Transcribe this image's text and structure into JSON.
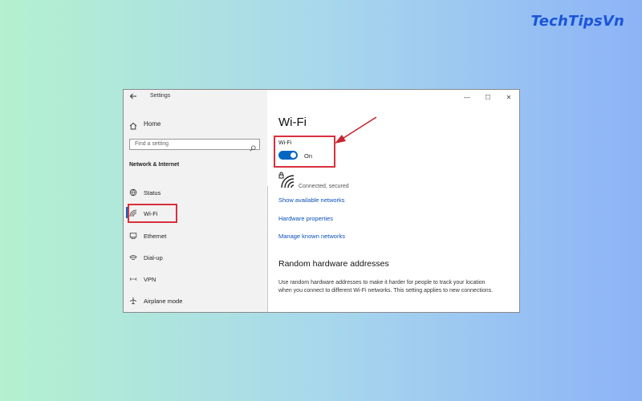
{
  "brand": "TechTipsVn",
  "window": {
    "app_title": "Settings",
    "controls": {
      "minimize": "—",
      "maximize": "☐",
      "close": "✕"
    }
  },
  "sidebar": {
    "home_label": "Home",
    "search_placeholder": "Find a setting",
    "section_title": "Network & Internet",
    "items": [
      {
        "label": "Status",
        "icon": "status-globe-icon"
      },
      {
        "label": "Wi-Fi",
        "icon": "wifi-icon",
        "active": true
      },
      {
        "label": "Ethernet",
        "icon": "ethernet-icon"
      },
      {
        "label": "Dial-up",
        "icon": "dialup-icon"
      },
      {
        "label": "VPN",
        "icon": "vpn-icon"
      },
      {
        "label": "Airplane mode",
        "icon": "airplane-icon"
      }
    ]
  },
  "content": {
    "page_title": "Wi-Fi",
    "wifi_label": "Wi-Fi",
    "toggle_state": "On",
    "network_status": "Connected, secured",
    "links": [
      "Show available networks",
      "Hardware properties",
      "Manage known networks"
    ],
    "random_hw_title": "Random hardware addresses",
    "random_hw_desc": "Use random hardware addresses to make it harder for people to track your location when you connect to different Wi-Fi networks. This setting applies to new connections."
  },
  "colors": {
    "accent": "#0067c0",
    "highlight": "#d9303c",
    "link": "#0a4fb8",
    "brand": "#1b55d8"
  }
}
